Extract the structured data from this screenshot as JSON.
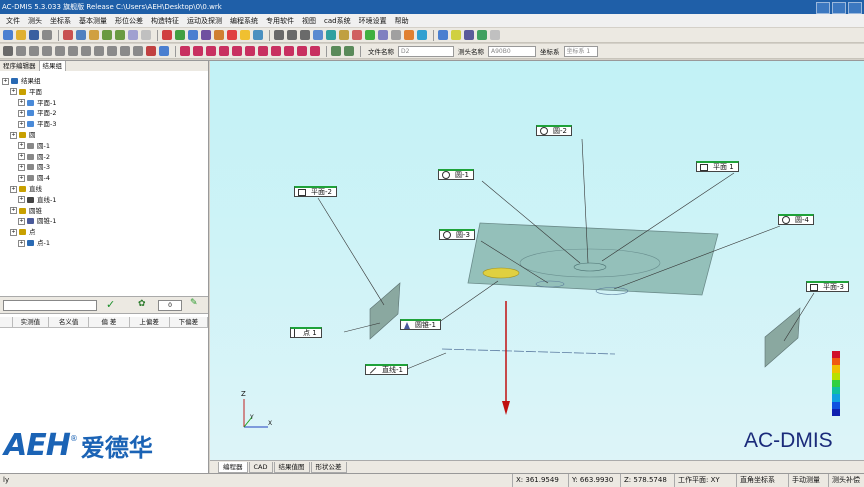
{
  "window": {
    "title": "AC-DMIS 5.3.033 旗舰版 Release    C:\\Users\\AEH\\Desktop\\0\\0.wrk"
  },
  "menu": [
    "文件",
    "测头",
    "坐标系",
    "基本测量",
    "形位公差",
    "构造特征",
    "运动及探测",
    "编程系统",
    "专用软件",
    "视图",
    "cad系统",
    "环境设置",
    "帮助"
  ],
  "toolbar3": {
    "file_name_label": "文件名称",
    "file_name_value": "D2",
    "probe_name_label": "测头名称",
    "probe_name_value": "A90B0",
    "coord_label": "坐标系",
    "coord_value": "坐标系 1"
  },
  "panel": {
    "tabs": [
      "程序编辑器",
      "结果组"
    ],
    "tree": [
      {
        "label": "结果组",
        "level": 0,
        "icon": "result-group",
        "color": "#2a6ab3"
      },
      {
        "label": "平面",
        "level": 1,
        "icon": "plane-group",
        "color": "#c8a000"
      },
      {
        "label": "平面-1",
        "level": 2,
        "icon": "plane",
        "color": "#4a8ad8"
      },
      {
        "label": "平面-2",
        "level": 2,
        "icon": "plane",
        "color": "#4a8ad8"
      },
      {
        "label": "平面-3",
        "level": 2,
        "icon": "plane",
        "color": "#4a8ad8"
      },
      {
        "label": "圆",
        "level": 1,
        "icon": "circle-group",
        "color": "#c8a000"
      },
      {
        "label": "圆-1",
        "level": 2,
        "icon": "circle",
        "color": "#888888"
      },
      {
        "label": "圆-2",
        "level": 2,
        "icon": "circle",
        "color": "#888888"
      },
      {
        "label": "圆-3",
        "level": 2,
        "icon": "circle",
        "color": "#888888"
      },
      {
        "label": "圆-4",
        "level": 2,
        "icon": "circle",
        "color": "#888888"
      },
      {
        "label": "直线",
        "level": 1,
        "icon": "line-group",
        "color": "#c8a000"
      },
      {
        "label": "直线-1",
        "level": 2,
        "icon": "line",
        "color": "#444444"
      },
      {
        "label": "圆锥",
        "level": 1,
        "icon": "cone-group",
        "color": "#c8a000"
      },
      {
        "label": "圆锥-1",
        "level": 2,
        "icon": "cone",
        "color": "#4a5a9a"
      },
      {
        "label": "点",
        "level": 1,
        "icon": "point-group",
        "color": "#c8a000"
      },
      {
        "label": "点-1",
        "level": 2,
        "icon": "point",
        "color": "#2a6ab3"
      }
    ],
    "counter_value": "0",
    "table_headers": [
      "",
      "实测值",
      "名义值",
      "偏 差",
      "上偏差",
      "下偏差"
    ]
  },
  "logo": {
    "latin": "AEH",
    "registered": "®",
    "chinese": "爱德华"
  },
  "viewport": {
    "labels": [
      {
        "text": "圆-2",
        "icon": "circle"
      },
      {
        "text": "圆-1",
        "icon": "circle"
      },
      {
        "text": "平面 1",
        "icon": "plane"
      },
      {
        "text": "平面-2",
        "icon": "plane"
      },
      {
        "text": "圆-3",
        "icon": "circle"
      },
      {
        "text": "圆-4",
        "icon": "circle"
      },
      {
        "text": "平面-3",
        "icon": "plane"
      },
      {
        "text": "点 1",
        "icon": "point"
      },
      {
        "text": "圆锥-1",
        "icon": "cone"
      },
      {
        "text": "直线-1",
        "icon": "line"
      }
    ],
    "axes": {
      "z": "Z",
      "y": "Y",
      "x": "X"
    },
    "brand": "AC-DMIS",
    "colorbar": [
      "#d0102a",
      "#f05a10",
      "#f0c000",
      "#b8e000",
      "#30d040",
      "#10c0a0",
      "#10a0e0",
      "#1050e0",
      "#1020b0"
    ],
    "tabs": [
      "编程器",
      "CAD",
      "结果值图",
      "形状公差"
    ]
  },
  "status": {
    "left": "ly",
    "x": "X: 361.9549",
    "y": "Y: 663.9930",
    "z": "Z: 578.5748",
    "plane": "工作平面: XY",
    "coord_sys": "直角坐标系",
    "mode1": "手动测量",
    "mode2": "测头补偿"
  }
}
